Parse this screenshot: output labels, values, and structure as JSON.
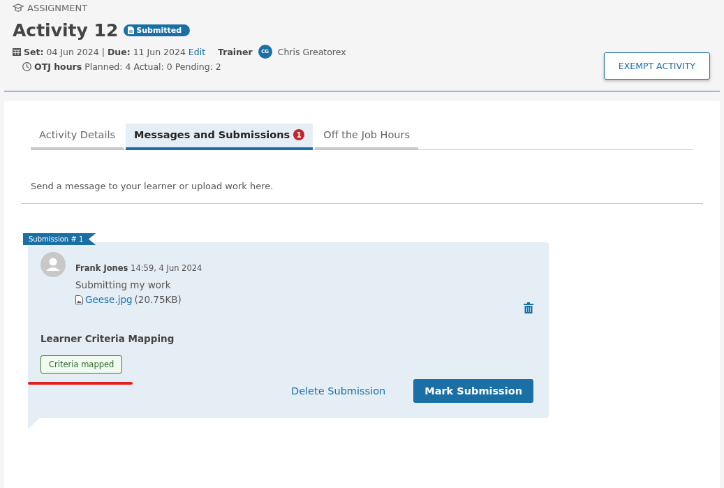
{
  "header": {
    "section_label": "ASSIGNMENT",
    "title": "Activity",
    "number": "12",
    "status_badge": "Submitted",
    "set_label": "Set:",
    "set_date": "04 Jun 2024",
    "separator": "|",
    "due_label": "Due:",
    "due_date": "11 Jun 2024",
    "edit_link": "Edit",
    "trainer_label": "Trainer",
    "trainer_initials": "CG",
    "trainer_name": "Chris Greatorex",
    "otj_label": "OTJ hours",
    "otj_values": "Planned: 4 Actual: 0 Pending: 2",
    "exempt_button": "EXEMPT ACTIVITY"
  },
  "tabs": [
    {
      "label": "Activity Details",
      "selected": false
    },
    {
      "label": "Messages and Submissions",
      "selected": true,
      "badge": "1"
    },
    {
      "label": "Off the Job Hours",
      "selected": false
    }
  ],
  "intro": "Send a message to your learner or upload work here.",
  "submission": {
    "ribbon": "Submission # 1",
    "author": "Frank Jones",
    "time": "14:59, 4 Jun 2024",
    "message": "Submitting my work",
    "file_name": "Geese.jpg",
    "file_size": "(20.75KB)",
    "mapping_title": "Learner Criteria Mapping",
    "mapping_status": "Criteria mapped",
    "delete_button": "Delete Submission",
    "mark_button": "Mark Submission"
  }
}
